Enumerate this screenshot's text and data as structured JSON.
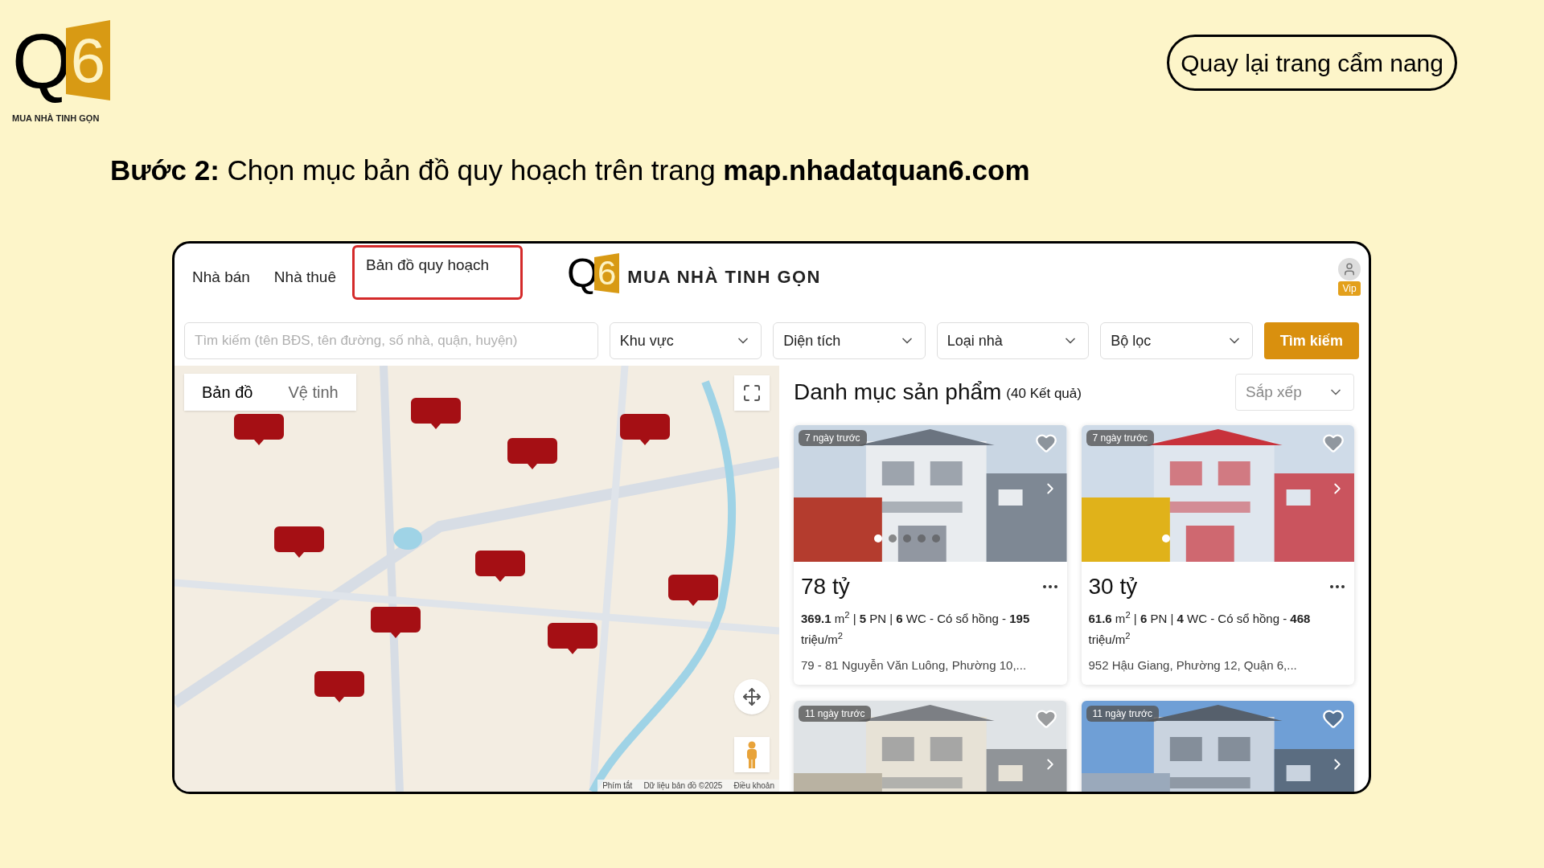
{
  "logo": {
    "letter": "Q",
    "digit": "6",
    "tagline": "MUA NHÀ TINH GỌN"
  },
  "back_button": "Quay lại trang cẩm nang",
  "instruction": "**Bước 2:** Chọn mục bản đồ quy hoạch trên trang **map.nhadatquan6.com**",
  "site": {
    "nav_tabs": [
      {
        "label": "Nhà bán",
        "selected": false
      },
      {
        "label": "Nhà thuê",
        "selected": false
      },
      {
        "label": "Bản đồ quy hoạch",
        "selected": true
      }
    ],
    "logo": {
      "letter": "Q",
      "digit": "6",
      "tagline": "MUA NHÀ TINH GỌN"
    },
    "user_badge": "Vip",
    "search": {
      "placeholder": "Tìm kiếm (tên BĐS, tên đường, số nhà, quận, huyện)"
    },
    "filters": [
      "Khu vực",
      "Diện tích",
      "Loại nhà",
      "Bộ lọc"
    ],
    "search_button": "Tìm kiếm",
    "map": {
      "types": [
        {
          "label": "Bản đồ",
          "selected": true
        },
        {
          "label": "Vệ tinh",
          "selected": false
        }
      ],
      "footer": [
        "Phím tắt",
        "Dữ liệu bản đồ ©2025",
        "Điều khoản"
      ]
    },
    "products": {
      "title": "Danh mục sản phẩm",
      "count": "(40 Kết quả)",
      "sort": "Sắp xếp",
      "cards": [
        {
          "age": "7 ngày trước",
          "slides": [
            {
              "selected": true
            },
            {
              "selected": false
            },
            {
              "selected": false
            },
            {
              "selected": false
            },
            {
              "selected": false
            }
          ],
          "price": "78 tỷ",
          "details": "**369.1** m$^{2}$ | **5** PN | **6** WC - Có sổ hồng - **195** triệu/m$^{2}$",
          "address": "79 - 81 Nguyễn Văn Luông, Phường 10,..."
        },
        {
          "age": "7 ngày trước",
          "slides": [
            {
              "selected": true
            }
          ],
          "price": "30 tỷ",
          "details": "**61.6** m$^{2}$ | **6** PN | **4** WC - Có sổ hồng - **468** triệu/m$^{2}$",
          "address": "952 Hậu Giang, Phường 12, Quận 6,..."
        },
        {
          "age": "11 ngày trước"
        },
        {
          "age": "11 ngày trước"
        }
      ]
    }
  }
}
